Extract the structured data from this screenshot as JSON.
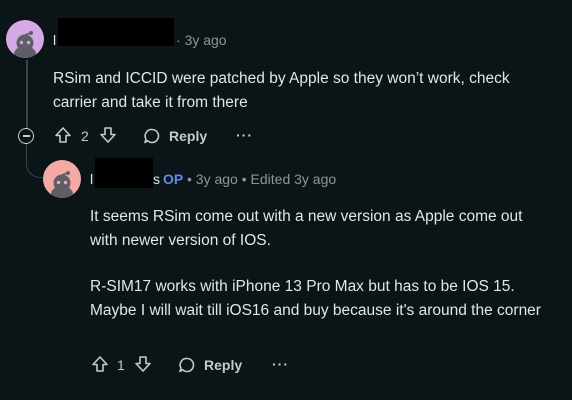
{
  "comments": [
    {
      "username_visible": "l",
      "time": "3y ago",
      "body": "RSim and ICCID were patched by Apple so they won’t work, check carrier and take it from there",
      "vote_count": "2",
      "reply_label": "Reply",
      "more_label": "···"
    },
    {
      "username_visible": "l",
      "username_tail": "s",
      "op_label": "OP",
      "time": "3y ago",
      "edited": "Edited 3y ago",
      "paragraphs": [
        "It seems RSim come out with a new version as Apple come out with newer version of IOS.",
        "R-SIM17 works with iPhone 13 Pro Max but has to be IOS 15. Maybe I will wait till iOS16 and buy because it's around the corner"
      ],
      "vote_count": "1",
      "reply_label": "Reply",
      "more_label": "···"
    }
  ],
  "separator": "•",
  "icons": [
    "snoo-avatar",
    "upvote-icon",
    "downvote-icon",
    "comment-bubble-icon",
    "collapse-icon"
  ],
  "colors": {
    "background": "#0b1416",
    "op": "#5c8cf0",
    "avatar1": "#d7a8e6",
    "avatar2": "#f4a9a5"
  }
}
